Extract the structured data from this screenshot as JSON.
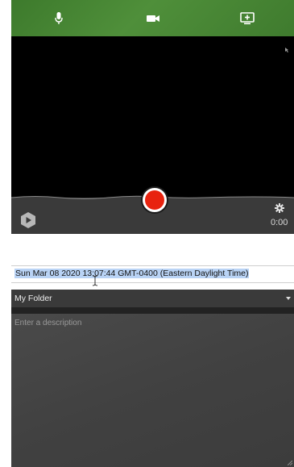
{
  "recorder": {
    "modes": [
      {
        "name": "microphone",
        "icon": "microphone-icon"
      },
      {
        "name": "camera",
        "icon": "video-camera-icon"
      },
      {
        "name": "screen",
        "icon": "screen-add-icon"
      }
    ],
    "timer": "0:00",
    "record_icon": "record-icon",
    "settings_icon": "gear-icon",
    "logo_icon": "logo-play-icon",
    "colors": {
      "mode_bar": "#4a8a36",
      "record": "#e8230f",
      "bottom_bar": "#3a3a3a"
    }
  },
  "form": {
    "title_value": "Sun Mar 08 2020 13:07:44 GMT-0400 (Eastern Daylight Time)",
    "folder_value": "My Folder",
    "description_placeholder": "Enter a description"
  }
}
